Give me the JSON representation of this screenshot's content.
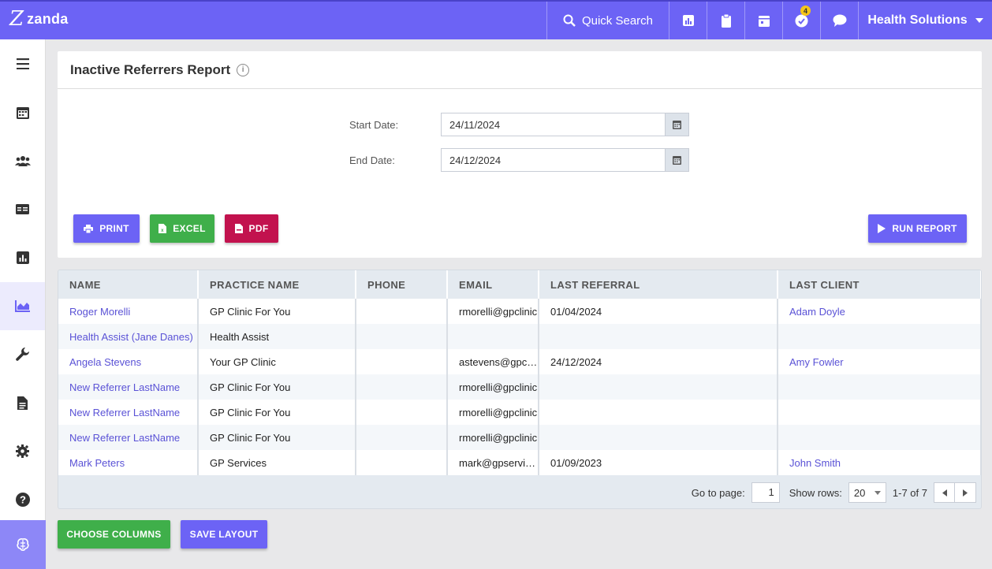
{
  "app": {
    "logo_text": "zanda"
  },
  "topbar": {
    "search_label": "Quick Search",
    "notification_count": "4",
    "org_name": "Health Solutions"
  },
  "report": {
    "title": "Inactive Referrers Report",
    "start_label": "Start Date:",
    "start_value": "24/11/2024",
    "end_label": "End Date:",
    "end_value": "24/12/2024",
    "print_label": "PRINT",
    "excel_label": "EXCEL",
    "pdf_label": "PDF",
    "run_label": "RUN REPORT"
  },
  "table": {
    "headers": [
      "NAME",
      "PRACTICE NAME",
      "PHONE",
      "EMAIL",
      "LAST REFERRAL",
      "LAST CLIENT"
    ],
    "rows": [
      [
        "Roger Morelli",
        "GP Clinic For You",
        "",
        "rmorelli@gpclinic",
        "01/04/2024",
        "Adam Doyle"
      ],
      [
        "Health Assist (Jane Danes)",
        "Health Assist",
        "",
        "",
        "",
        ""
      ],
      [
        "Angela Stevens",
        "Your GP Clinic",
        "",
        "astevens@gpclinic",
        "24/12/2024",
        "Amy Fowler"
      ],
      [
        "New Referrer LastName",
        "GP Clinic For You",
        "",
        "rmorelli@gpclinic",
        "",
        ""
      ],
      [
        "New Referrer LastName",
        "GP Clinic For You",
        "",
        "rmorelli@gpclinic",
        "",
        ""
      ],
      [
        "New Referrer LastName",
        "GP Clinic For You",
        "",
        "rmorelli@gpclinic",
        "",
        ""
      ],
      [
        "Mark Peters",
        "GP Services",
        "",
        "mark@gpservices",
        "01/09/2023",
        "John Smith"
      ]
    ]
  },
  "pager": {
    "goto_label": "Go to page:",
    "page_value": "1",
    "rows_label": "Show rows:",
    "rows_value": "20",
    "range_text": "1-7 of 7"
  },
  "footer": {
    "choose_columns_label": "CHOOSE COLUMNS",
    "save_layout_label": "SAVE LAYOUT"
  },
  "colors": {
    "brand": "#6c63f5",
    "excel": "#3faf4a",
    "pdf": "#c2124e",
    "link": "#5a52d6"
  }
}
